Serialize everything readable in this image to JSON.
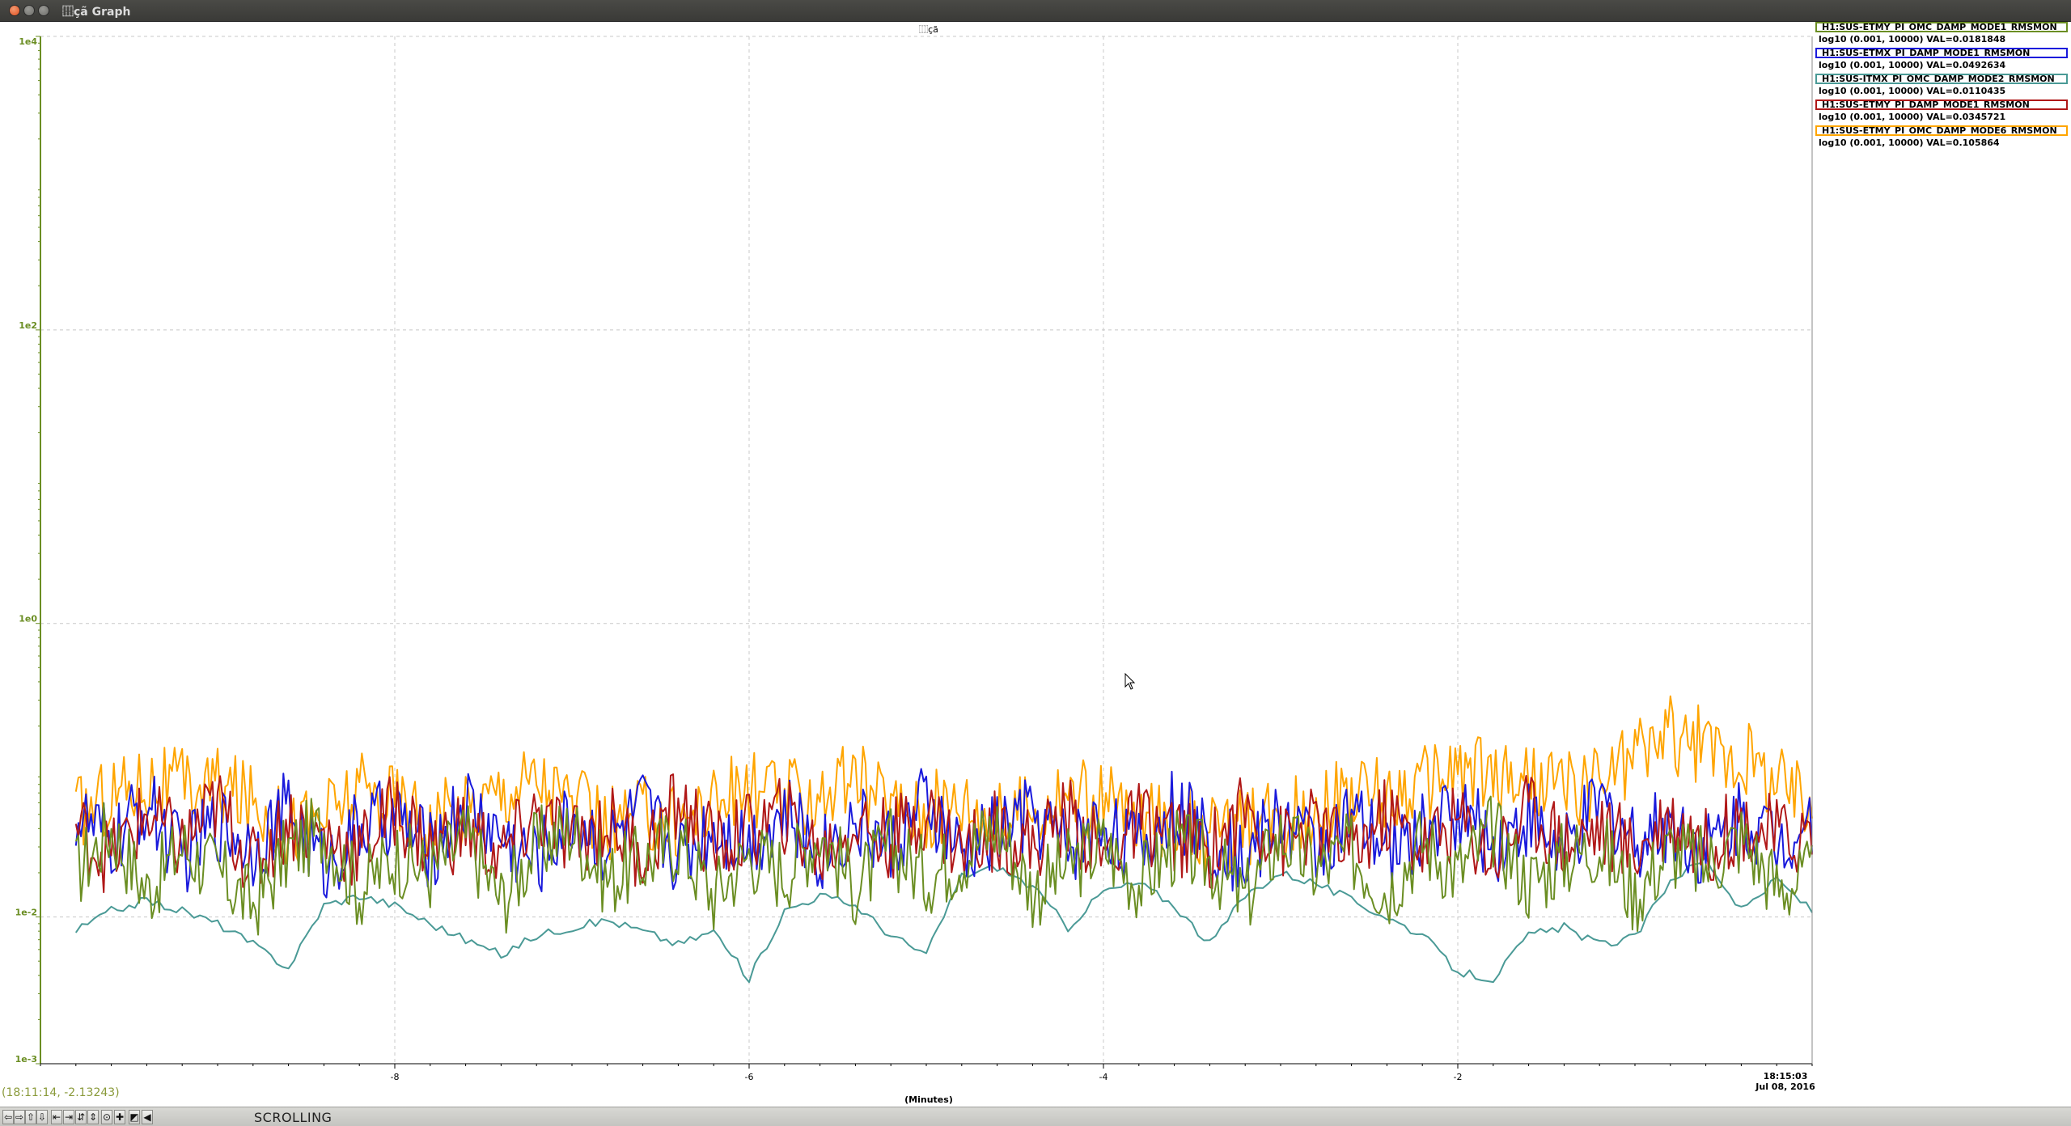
{
  "window": {
    "title": "⿲çã Graph"
  },
  "plot_title": "⿲çã",
  "legend": [
    {
      "channel": "H1:SUS-ETMY_PI_OMC_DAMP_MODE1_RMSMON",
      "info": "log10 (0.001, 10000) VAL=0.0181848",
      "color": "#6b8e23"
    },
    {
      "channel": "H1:SUS-ETMX_PI_DAMP_MODE1_RMSMON",
      "info": "log10 (0.001, 10000) VAL=0.0492634",
      "color": "#1a1adc"
    },
    {
      "channel": "H1:SUS-ITMX_PI_OMC_DAMP_MODE2_RMSMON",
      "info": "log10 (0.001, 10000) VAL=0.0110435",
      "color": "#4a9a96"
    },
    {
      "channel": "H1:SUS-ETMY_PI_DAMP_MODE1_RMSMON",
      "info": "log10 (0.001, 10000) VAL=0.0345721",
      "color": "#b01818"
    },
    {
      "channel": "H1:SUS-ETMY_PI_OMC_DAMP_MODE6_RMSMON",
      "info": "log10 (0.001, 10000) VAL=0.105864",
      "color": "#ffa500"
    }
  ],
  "time_label": {
    "time": "18:15:03",
    "date": "Jul 08, 2016"
  },
  "coordinate_readout": "(18:11:14, -2.13243)",
  "toolbar": {
    "buttons": [
      "⇦",
      "⇨",
      "⇧",
      "⇩",
      "⇤",
      "⇥",
      "⇵",
      "⇕",
      "⊙",
      "✚",
      "◩",
      "◀"
    ],
    "mode": "SCROLLING"
  },
  "colors": {
    "axis": "#6b8e23",
    "grid": "#c8c8c8"
  },
  "chart_data": {
    "type": "line",
    "xlabel": "(Minutes)",
    "ylabel": "",
    "xlim": [
      -10.0,
      0
    ],
    "x_ticks": [
      -8,
      -6,
      -4,
      -2
    ],
    "y_scale": "log",
    "ylim": [
      0.001,
      10000
    ],
    "y_ticks": [
      {
        "value": 0.001,
        "label": "1e-3"
      },
      {
        "value": 0.01,
        "label": "1e-2"
      },
      {
        "value": 1,
        "label": "1e0"
      },
      {
        "value": 100,
        "label": "1e2"
      },
      {
        "value": 10000,
        "label": "1e4"
      }
    ],
    "grid": true,
    "legend_position": "top-right",
    "x": [
      -9.8,
      -9.6,
      -9.4,
      -9.2,
      -9.0,
      -8.8,
      -8.6,
      -8.4,
      -8.2,
      -8.0,
      -7.8,
      -7.6,
      -7.4,
      -7.2,
      -7.0,
      -6.8,
      -6.6,
      -6.4,
      -6.2,
      -6.0,
      -5.8,
      -5.6,
      -5.4,
      -5.2,
      -5.0,
      -4.8,
      -4.6,
      -4.4,
      -4.2,
      -4.0,
      -3.8,
      -3.6,
      -3.4,
      -3.2,
      -3.0,
      -2.8,
      -2.6,
      -2.4,
      -2.2,
      -2.0,
      -1.8,
      -1.6,
      -1.4,
      -1.2,
      -1.0,
      -0.8,
      -0.6,
      -0.4,
      -0.2,
      0.0
    ],
    "series": [
      {
        "name": "H1:SUS-ETMY_PI_OMC_DAMP_MODE1_RMSMON",
        "values": [
          0.02,
          0.04,
          0.015,
          0.03,
          0.02,
          0.012,
          0.028,
          0.04,
          0.015,
          0.026,
          0.02,
          0.035,
          0.013,
          0.03,
          0.04,
          0.018,
          0.024,
          0.033,
          0.014,
          0.027,
          0.02,
          0.038,
          0.016,
          0.03,
          0.019,
          0.026,
          0.042,
          0.015,
          0.022,
          0.031,
          0.017,
          0.03,
          0.024,
          0.013,
          0.036,
          0.021,
          0.028,
          0.015,
          0.033,
          0.02,
          0.039,
          0.017,
          0.025,
          0.031,
          0.014,
          0.029,
          0.022,
          0.035,
          0.016,
          0.018
        ]
      },
      {
        "name": "H1:SUS-ETMX_PI_DAMP_MODE1_RMSMON",
        "values": [
          0.05,
          0.03,
          0.06,
          0.025,
          0.045,
          0.03,
          0.055,
          0.022,
          0.04,
          0.05,
          0.028,
          0.06,
          0.035,
          0.024,
          0.048,
          0.03,
          0.055,
          0.026,
          0.042,
          0.033,
          0.05,
          0.027,
          0.045,
          0.03,
          0.06,
          0.025,
          0.04,
          0.05,
          0.03,
          0.045,
          0.028,
          0.055,
          0.035,
          0.025,
          0.05,
          0.03,
          0.046,
          0.027,
          0.038,
          0.055,
          0.031,
          0.048,
          0.026,
          0.06,
          0.034,
          0.045,
          0.028,
          0.052,
          0.033,
          0.049
        ]
      },
      {
        "name": "H1:SUS-ITMX_PI_OMC_DAMP_MODE2_RMSMON",
        "values": [
          0.008,
          0.011,
          0.013,
          0.011,
          0.009,
          0.0065,
          0.0045,
          0.012,
          0.014,
          0.012,
          0.009,
          0.007,
          0.0055,
          0.0075,
          0.0085,
          0.0095,
          0.008,
          0.0065,
          0.008,
          0.0038,
          0.011,
          0.014,
          0.012,
          0.0075,
          0.0055,
          0.019,
          0.022,
          0.016,
          0.0085,
          0.015,
          0.017,
          0.012,
          0.0065,
          0.014,
          0.02,
          0.017,
          0.013,
          0.01,
          0.0075,
          0.0042,
          0.0038,
          0.0075,
          0.0085,
          0.0065,
          0.0072,
          0.018,
          0.025,
          0.011,
          0.018,
          0.011
        ]
      },
      {
        "name": "H1:SUS-ETMY_PI_DAMP_MODE1_RMSMON",
        "values": [
          0.04,
          0.025,
          0.05,
          0.03,
          0.06,
          0.022,
          0.045,
          0.035,
          0.028,
          0.055,
          0.03,
          0.04,
          0.025,
          0.05,
          0.032,
          0.045,
          0.027,
          0.06,
          0.03,
          0.038,
          0.05,
          0.026,
          0.044,
          0.033,
          0.055,
          0.028,
          0.04,
          0.03,
          0.05,
          0.025,
          0.045,
          0.036,
          0.028,
          0.055,
          0.032,
          0.042,
          0.027,
          0.05,
          0.03,
          0.046,
          0.026,
          0.055,
          0.033,
          0.04,
          0.028,
          0.05,
          0.03,
          0.045,
          0.035,
          0.036
        ]
      },
      {
        "name": "H1:SUS-ETMY_PI_OMC_DAMP_MODE6_RMSMON",
        "values": [
          0.05,
          0.07,
          0.085,
          0.075,
          0.08,
          0.06,
          0.04,
          0.05,
          0.07,
          0.065,
          0.045,
          0.055,
          0.075,
          0.09,
          0.06,
          0.04,
          0.05,
          0.045,
          0.06,
          0.075,
          0.065,
          0.07,
          0.085,
          0.06,
          0.05,
          0.065,
          0.045,
          0.055,
          0.07,
          0.06,
          0.045,
          0.05,
          0.035,
          0.04,
          0.045,
          0.055,
          0.07,
          0.065,
          0.08,
          0.1,
          0.09,
          0.085,
          0.075,
          0.085,
          0.13,
          0.18,
          0.14,
          0.12,
          0.085,
          0.055
        ]
      }
    ]
  }
}
